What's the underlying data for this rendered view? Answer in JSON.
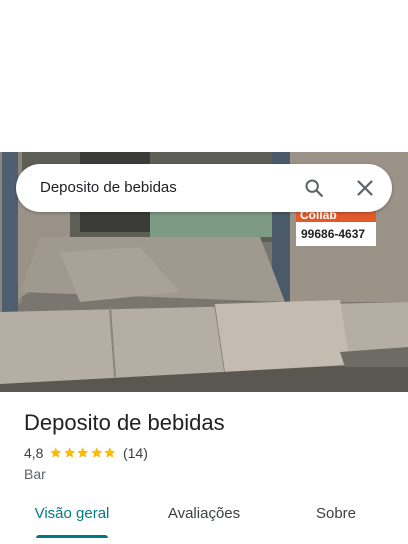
{
  "search": {
    "query": "Deposito de bebidas"
  },
  "photo": {
    "sign_text": "Collab",
    "sign_phone": "99686-4637"
  },
  "place": {
    "name": "Deposito de bebidas",
    "rating": "4,8",
    "rating_value": 4.8,
    "reviews": "(14)",
    "category": "Bar"
  },
  "tabs": [
    {
      "label": "Visão geral",
      "active": true
    },
    {
      "label": "Avaliações",
      "active": false
    },
    {
      "label": "Sobre",
      "active": false
    }
  ],
  "colors": {
    "accent": "#007b83",
    "star": "#fbbc04"
  }
}
